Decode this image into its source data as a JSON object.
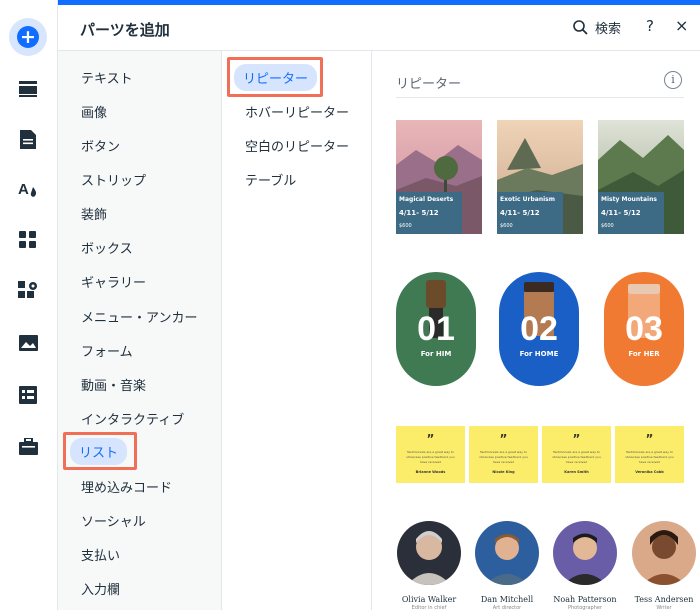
{
  "panel": {
    "title": "パーツを追加",
    "search_label": "検索",
    "help_label": "?",
    "close_label": "×"
  },
  "rail": {
    "icons": [
      "add-icon",
      "section-icon",
      "page-icon",
      "theme-icon",
      "apps-icon",
      "app-market-icon",
      "media-icon",
      "cms-icon",
      "business-icon"
    ]
  },
  "categories": [
    "テキスト",
    "画像",
    "ボタン",
    "ストリップ",
    "装飾",
    "ボックス",
    "ギャラリー",
    "メニュー・アンカー",
    "フォーム",
    "動画・音楽",
    "インタラクティブ",
    "リスト",
    "埋め込みコード",
    "ソーシャル",
    "支払い",
    "入力欄"
  ],
  "selected_category": "リスト",
  "subcategories": [
    "リピーター",
    "ホバーリピーター",
    "空白のリピーター",
    "テーブル"
  ],
  "selected_subcategory": "リピーター",
  "preview": {
    "section_title": "リピーター",
    "info_label": "i",
    "travel_cards": [
      {
        "name": "Magical Deserts",
        "dates": "4/11- 5/12",
        "price": "$600"
      },
      {
        "name": "Exotic Urbanism",
        "dates": "4/11- 5/12",
        "price": "$600"
      },
      {
        "name": "Misty Mountains",
        "dates": "4/11- 5/12",
        "price": "$600"
      }
    ],
    "product_cards": [
      {
        "number": "01",
        "label": "For HIM",
        "color": "#3f7a52"
      },
      {
        "number": "02",
        "label": "For HOME",
        "color": "#1a5fc6"
      },
      {
        "number": "03",
        "label": "For HER",
        "color": "#f07a32"
      }
    ],
    "quote_cards": [
      {
        "mark": "”",
        "text": "Testimonials are a great way to showcase positive feedback you have received",
        "author": "Brianne Woods"
      },
      {
        "mark": "”",
        "text": "Testimonials are a great way to showcase positive feedback you have received",
        "author": "Nicole King"
      },
      {
        "mark": "”",
        "text": "Testimonials are a great way to showcase positive feedback you have received",
        "author": "Karen Smith"
      },
      {
        "mark": "”",
        "text": "Testimonials are a great way to showcase positive feedback you have received",
        "author": "Veronika Cobb"
      }
    ],
    "team": [
      {
        "name": "Olivia Walker",
        "role": "Editor in chief"
      },
      {
        "name": "Dan Mitchell",
        "role": "Art director"
      },
      {
        "name": "Noah Patterson",
        "role": "Photographer"
      },
      {
        "name": "Tess Andersen",
        "role": "Writer"
      }
    ]
  },
  "colors": {
    "accent": "#116dff",
    "highlight_border": "#f16f56",
    "selected_pill": "#d6e5fd"
  }
}
